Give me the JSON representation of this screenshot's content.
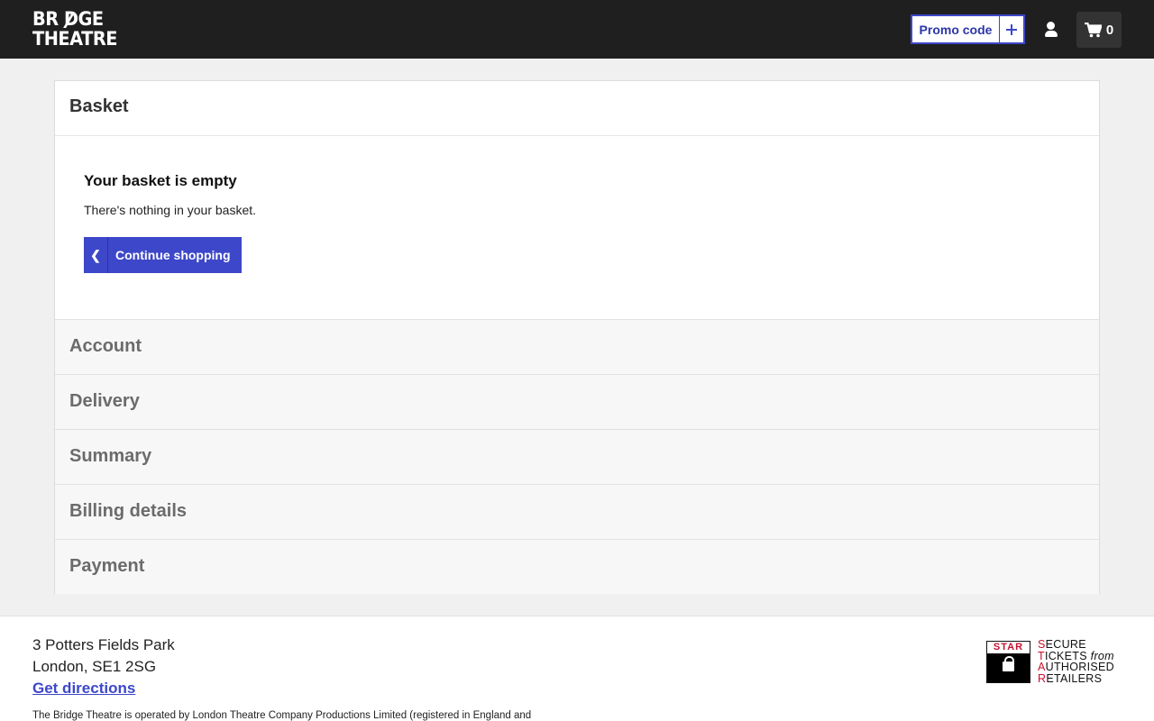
{
  "header": {
    "logo_line1": "BR DGE",
    "logo_line2": "THEATRE",
    "promo_label": "Promo code",
    "cart_count": "0"
  },
  "basket": {
    "title": "Basket",
    "empty_title": "Your basket is empty",
    "empty_text": "There's nothing in your basket.",
    "continue_label": "Continue shopping"
  },
  "steps": [
    {
      "label": "Account"
    },
    {
      "label": "Delivery"
    },
    {
      "label": "Summary"
    },
    {
      "label": "Billing details"
    },
    {
      "label": "Payment"
    }
  ],
  "footer": {
    "address_line1": "3 Potters Fields Park",
    "address_line2": "London, SE1 2SG",
    "directions_label": "Get directions",
    "legal_text": "The Bridge Theatre is operated by London Theatre Company Productions Limited (registered in England and",
    "star_word": "STAR",
    "star_line1": "ECURE",
    "star_line2": "ICKETS",
    "star_from": "from",
    "star_line3": "UTHORISED",
    "star_line4": "ETAILERS",
    "star_cap1": "S",
    "star_cap2": "T",
    "star_cap3": "A",
    "star_cap4": "R"
  },
  "colors": {
    "accent": "#3d47c9",
    "topbar": "#1f1f1f",
    "star_red": "#c8102e"
  }
}
